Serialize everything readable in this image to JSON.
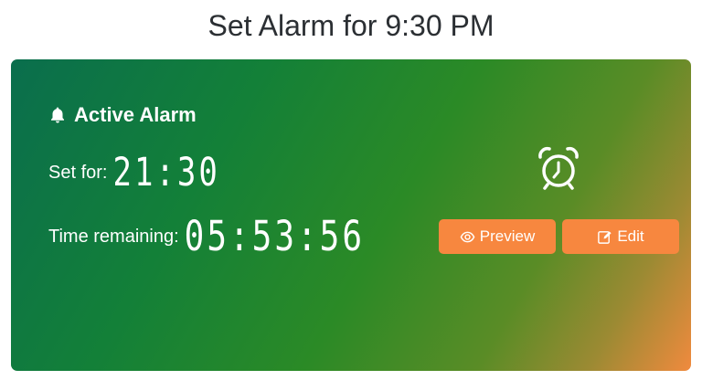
{
  "page": {
    "title": "Set Alarm for 9:30 PM"
  },
  "card": {
    "header": "Active Alarm",
    "set_for_label": "Set for:",
    "set_for_value": "21:30",
    "remaining_label": "Time remaining:",
    "remaining_value": "05:53:56",
    "icons": {
      "header": "bell-icon",
      "main": "alarm-clock-icon"
    },
    "colors": {
      "gradient_start": "#0a6e4d",
      "gradient_end": "#f08a3e",
      "button": "#f7873f"
    }
  },
  "buttons": {
    "preview_label": "Preview",
    "edit_label": "Edit",
    "preview_icon": "eye-icon",
    "edit_icon": "edit-icon"
  }
}
